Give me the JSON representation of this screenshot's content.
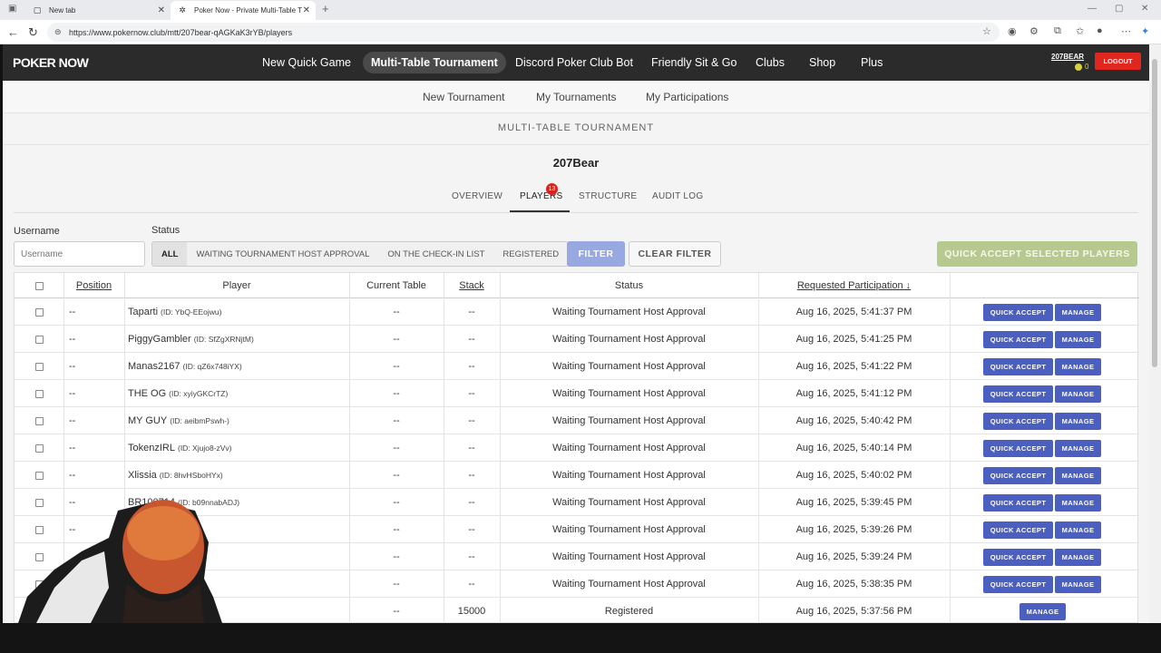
{
  "browser": {
    "tabs": [
      {
        "title": "New tab"
      },
      {
        "title": "Poker Now - Private Multi-Table T"
      }
    ],
    "url": "https://www.pokernow.club/mtt/207bear-qAGKaK3rYB/players"
  },
  "nav": {
    "logo": "POKER NOW",
    "items": [
      "New Quick Game",
      "Multi-Table Tournament",
      "Discord Poker Club Bot",
      "Friendly Sit & Go",
      "Clubs",
      "Shop",
      "Plus"
    ],
    "user": "207BEAR",
    "chips": "0",
    "logout": "LOGOUT"
  },
  "subnav": [
    "New Tournament",
    "My Tournaments",
    "My Participations"
  ],
  "section_title": "MULTI-TABLE TOURNAMENT",
  "tournament_name": "207Bear",
  "tabs": [
    "OVERVIEW",
    "PLAYERS",
    "STRUCTURE",
    "AUDIT LOG"
  ],
  "players_badge": "13",
  "filters": {
    "username_label": "Username",
    "username_placeholder": "Username",
    "status_label": "Status",
    "status_options": [
      "ALL",
      "WAITING TOURNAMENT HOST APPROVAL",
      "ON THE CHECK-IN LIST",
      "REGISTERED"
    ],
    "filter_button": "FILTER",
    "clear_button": "CLEAR FILTER",
    "quick_accept_selected": "QUICK ACCEPT SELECTED PLAYERS"
  },
  "table": {
    "headers": [
      "Position",
      "Player",
      "Current Table",
      "Stack",
      "Status",
      "Requested Participation ↓"
    ],
    "quick_accept_label": "QUICK ACCEPT",
    "manage_label": "MANAGE",
    "rows": [
      {
        "position": "--",
        "name": "Taparti",
        "id": "(ID: YbQ-EEojwu)",
        "table": "--",
        "stack": "--",
        "status": "Waiting Tournament Host Approval",
        "requested": "Aug 16, 2025, 5:41:37 PM",
        "pending": true
      },
      {
        "position": "--",
        "name": "PiggyGambler",
        "id": "(ID: SfZgXRNjtM)",
        "table": "--",
        "stack": "--",
        "status": "Waiting Tournament Host Approval",
        "requested": "Aug 16, 2025, 5:41:25 PM",
        "pending": true
      },
      {
        "position": "--",
        "name": "Manas2167",
        "id": "(ID: qZ6x748iYX)",
        "table": "--",
        "stack": "--",
        "status": "Waiting Tournament Host Approval",
        "requested": "Aug 16, 2025, 5:41:22 PM",
        "pending": true
      },
      {
        "position": "--",
        "name": "THE OG",
        "id": "(ID: xyiyGKCrTZ)",
        "table": "--",
        "stack": "--",
        "status": "Waiting Tournament Host Approval",
        "requested": "Aug 16, 2025, 5:41:12 PM",
        "pending": true
      },
      {
        "position": "--",
        "name": "MY GUY",
        "id": "(ID: aeibmPswh-)",
        "table": "--",
        "stack": "--",
        "status": "Waiting Tournament Host Approval",
        "requested": "Aug 16, 2025, 5:40:42 PM",
        "pending": true
      },
      {
        "position": "--",
        "name": "TokenzIRL",
        "id": "(ID: Xjujo8-zVv)",
        "table": "--",
        "stack": "--",
        "status": "Waiting Tournament Host Approval",
        "requested": "Aug 16, 2025, 5:40:14 PM",
        "pending": true
      },
      {
        "position": "--",
        "name": "Xlissia",
        "id": "(ID: 8hvHSboHYx)",
        "table": "--",
        "stack": "--",
        "status": "Waiting Tournament Host Approval",
        "requested": "Aug 16, 2025, 5:40:02 PM",
        "pending": true
      },
      {
        "position": "--",
        "name": "BR100714",
        "id": "(ID: b09nnabADJ)",
        "table": "--",
        "stack": "--",
        "status": "Waiting Tournament Host Approval",
        "requested": "Aug 16, 2025, 5:39:45 PM",
        "pending": true
      },
      {
        "position": "--",
        "name": "",
        "id": "A32h9l-Vlx)",
        "table": "--",
        "stack": "--",
        "status": "Waiting Tournament Host Approval",
        "requested": "Aug 16, 2025, 5:39:26 PM",
        "pending": true
      },
      {
        "position": "",
        "name": "",
        "id": "D: fNW15czd-y)",
        "table": "--",
        "stack": "--",
        "status": "Waiting Tournament Host Approval",
        "requested": "Aug 16, 2025, 5:39:24 PM",
        "pending": true
      },
      {
        "position": "--",
        "name": "",
        "id": "V9ytS)",
        "table": "--",
        "stack": "--",
        "status": "Waiting Tournament Host Approval",
        "requested": "Aug 16, 2025, 5:38:35 PM",
        "pending": true
      },
      {
        "position": "",
        "name": "",
        "id": "kmAt)",
        "table": "--",
        "stack": "15000",
        "status": "Registered",
        "requested": "Aug 16, 2025, 5:37:56 PM",
        "pending": false
      }
    ]
  },
  "colors": {
    "nav_bg": "#2b2b2b",
    "logout": "#e0271f",
    "action_button": "#4b5fc1",
    "filter_button": "#98a8e0",
    "quick_accept_selected": "#b8c990",
    "badge": "#d9241c"
  }
}
